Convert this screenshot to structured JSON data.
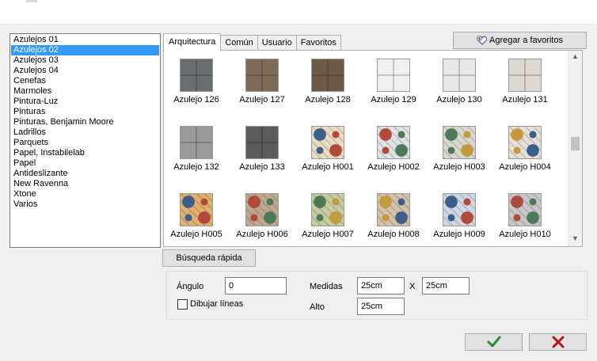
{
  "categories": {
    "selected_index": 1,
    "items": [
      "Azulejos 01",
      "Azulejos 02",
      "Azulejos 03",
      "Azulejos 04",
      "Cenefas",
      "Marmoles",
      "Pintura-Luz",
      "Pinturas",
      "Pinturas, Benjamin Moore",
      "Ladrillos",
      "Parquets",
      "Papel, Instabilelab",
      "Papel",
      "Antideslizante",
      "New Ravenna",
      "Xtone",
      "Varios"
    ]
  },
  "tabs": {
    "active_index": 0,
    "items": [
      "Arquitectura",
      "Común",
      "Usuario",
      "Favoritos"
    ]
  },
  "favorites_button": {
    "label": "Agregar a favoritos",
    "icon": "heart-add-icon"
  },
  "tiles": [
    {
      "label": "Azulejo 126",
      "color": "#6a6d70",
      "pattern": "plain"
    },
    {
      "label": "Azulejo 127",
      "color": "#7e6a56",
      "pattern": "plain"
    },
    {
      "label": "Azulejo 128",
      "color": "#6c5a48",
      "pattern": "plain"
    },
    {
      "label": "Azulejo 129",
      "color": "#f0f0f0",
      "pattern": "plain"
    },
    {
      "label": "Azulejo 130",
      "color": "#e8e8e8",
      "pattern": "plain"
    },
    {
      "label": "Azulejo 131",
      "color": "#ddd8d0",
      "pattern": "plain"
    },
    {
      "label": "Azulejo 132",
      "color": "#9a9a9a",
      "pattern": "plain"
    },
    {
      "label": "Azulejo 133",
      "color": "#5a5a5a",
      "pattern": "plain"
    },
    {
      "label": "Azulejo H001",
      "color": "#e9dcc2",
      "pattern": "hydraulic"
    },
    {
      "label": "Azulejo H002",
      "color": "#dfe3e6",
      "pattern": "hydraulic"
    },
    {
      "label": "Azulejo H003",
      "color": "#dad8d0",
      "pattern": "hydraulic"
    },
    {
      "label": "Azulejo H004",
      "color": "#e6e0d6",
      "pattern": "hydraulic"
    },
    {
      "label": "Azulejo H005",
      "color": "#e0b070",
      "pattern": "hydraulic"
    },
    {
      "label": "Azulejo H006",
      "color": "#c0a890",
      "pattern": "hydraulic"
    },
    {
      "label": "Azulejo H007",
      "color": "#c7cda0",
      "pattern": "hydraulic"
    },
    {
      "label": "Azulejo H008",
      "color": "#d6c2a8",
      "pattern": "hydraulic"
    },
    {
      "label": "Azulejo H009",
      "color": "#d0d8e4",
      "pattern": "hydraulic"
    },
    {
      "label": "Azulejo H010",
      "color": "#c8c8c8",
      "pattern": "hydraulic"
    }
  ],
  "tile_accents": [
    "#3b5f8a",
    "#b04a3a",
    "#4d7a56",
    "#c49a3c"
  ],
  "quick_search": {
    "label": "Búsqueda rápida"
  },
  "props": {
    "angle_label": "Ángulo",
    "angle_value": "0",
    "draw_lines_label": "Dibujar líneas",
    "draw_lines_checked": false,
    "size_label": "Medidas",
    "width_value": "25cm",
    "times_symbol": "X",
    "height_value": "25cm",
    "alto_label": "Alto",
    "alto_value": "25cm"
  },
  "buttons": {
    "ok_icon": "checkmark-icon",
    "ok_color": "#2e8b2e",
    "cancel_icon": "x-icon",
    "cancel_color": "#b01818"
  }
}
